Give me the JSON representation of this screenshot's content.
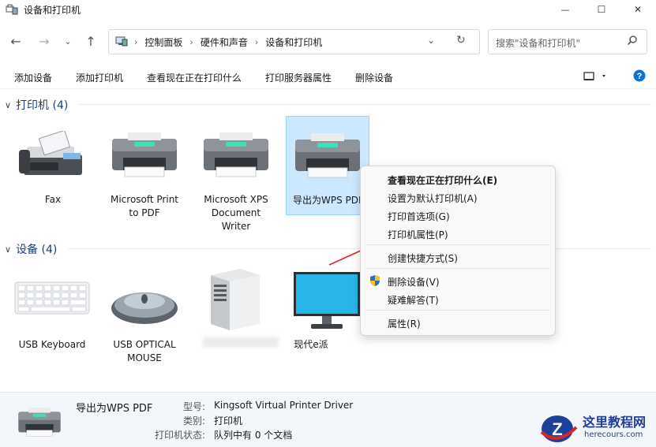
{
  "window": {
    "title": "设备和打印机",
    "controls": {
      "minimize": "—",
      "maximize": "☐",
      "close": "✕"
    }
  },
  "nav": {
    "breadcrumb": [
      "控制面板",
      "硬件和声音",
      "设备和打印机"
    ],
    "search_placeholder": "搜索\"设备和打印机\""
  },
  "toolbar": {
    "commands": [
      "添加设备",
      "添加打印机",
      "查看现在正在打印什么",
      "打印服务器属性",
      "删除设备"
    ]
  },
  "groups": {
    "printers": {
      "header": "打印机 (4)",
      "items": [
        {
          "label1": "Fax",
          "label2": "",
          "label3": ""
        },
        {
          "label1": "Microsoft Print",
          "label2": "to PDF",
          "label3": ""
        },
        {
          "label1": "Microsoft XPS",
          "label2": "Document",
          "label3": "Writer"
        },
        {
          "label1": "导出为WPS PDF",
          "label2": "",
          "label3": ""
        }
      ]
    },
    "devices": {
      "header": "设备 (4)",
      "items": [
        {
          "label1": "USB Keyboard",
          "label2": ""
        },
        {
          "label1": "USB OPTICAL",
          "label2": "MOUSE"
        },
        {
          "label1": "",
          "label2": ""
        },
        {
          "label1": "现代e派",
          "label2": ""
        }
      ]
    }
  },
  "context_menu": {
    "items": [
      "查看现在正在打印什么(E)",
      "设置为默认打印机(A)",
      "打印首选项(G)",
      "打印机属性(P)",
      "创建快捷方式(S)",
      "删除设备(V)",
      "疑难解答(T)",
      "属性(R)"
    ]
  },
  "status": {
    "name": "导出为WPS PDF",
    "model_label": "型号:",
    "model_value": "Kingsoft Virtual Printer Driver",
    "category_label": "类别:",
    "category_value": "打印机",
    "state_label": "打印机状态:",
    "state_value": "队列中有 0 个文档"
  },
  "watermark": {
    "site_name": "这里教程网",
    "site_url": "herecours.com"
  },
  "colors": {
    "accent": "#0a73d4",
    "selection": "#cce8ff",
    "header_text": "#1e3f7a",
    "arrow": "#d9262b"
  }
}
